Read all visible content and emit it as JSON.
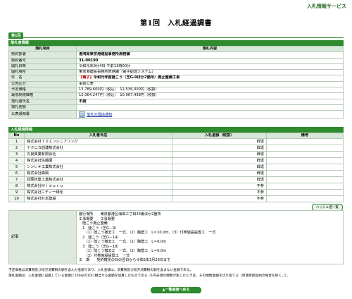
{
  "header": {
    "service": "入札情報サービス",
    "title": "第1回　入札経過調書",
    "round_badge": "第1回"
  },
  "info_section": {
    "heading": "落札者情報",
    "col_item": "落札項目",
    "col_content": "落札内容",
    "rows": [
      {
        "label": "契約部署",
        "value": "港湾局東京港建設事務所庶務課"
      },
      {
        "label": "契約番号",
        "value": "31-00190"
      },
      {
        "label": "開札日時",
        "value": "令和元年9月4日 午前11時00分"
      },
      {
        "label": "開札場所",
        "value": "東京港建設事務所庶務課（電子調達システム）"
      },
      {
        "label": "件　名",
        "tag": "【電子】",
        "value": "令和元年度陸こう（芝G-9ほか2箇所）廃止整備工事"
      },
      {
        "label": "公告区分",
        "value": "事前公表"
      },
      {
        "label": "予定価格",
        "value": "13,789,600円（税込）　12,536,000円（税抜）"
      },
      {
        "label": "最低制限価格",
        "value": "12,064,247円（税込）　10,967,498円（税抜）"
      },
      {
        "label": "落札者氏名",
        "value": "不調"
      },
      {
        "label": "落札金額",
        "value": ""
      },
      {
        "label": "公表通知書",
        "value": "落札の理由通知"
      }
    ]
  },
  "bid_section": {
    "heading": "入札経過情報",
    "col_no": "No",
    "col_name": "入札者氏名",
    "col_amount": "入札金額（税抜）",
    "col_note": "備考",
    "rows": [
      {
        "no": "1",
        "name": "株式会社ＴＤエンジニアリング",
        "amount": "辞退",
        "note": ""
      },
      {
        "no": "2",
        "name": "テクニカ創建株式会社",
        "amount": "辞退",
        "note": ""
      },
      {
        "no": "3",
        "name": "丸良興業有限会社",
        "amount": "辞退",
        "note": ""
      },
      {
        "no": "4",
        "name": "株式会社佐藤園",
        "amount": "辞退",
        "note": ""
      },
      {
        "no": "5",
        "name": "シンレキ工業株式会社",
        "amount": "辞退",
        "note": ""
      },
      {
        "no": "6",
        "name": "株式会社森岡",
        "amount": "辞退",
        "note": ""
      },
      {
        "no": "7",
        "name": "武蔵技建工業株式会社",
        "amount": "辞退",
        "note": ""
      },
      {
        "no": "8",
        "name": "株式会社Ｍｉｄｏｒｕ",
        "amount": "不参",
        "note": ""
      },
      {
        "no": "9",
        "name": "株式会社ニチノー緑化",
        "amount": "不参",
        "note": ""
      },
      {
        "no": "10",
        "name": "株式会社杉本建設",
        "amount": "不参",
        "note": ""
      }
    ],
    "hash_button": "ハッシュ値一覧"
  },
  "remarks": {
    "label": "記事",
    "text": "履行場所　　東京都港区海岸三丁目33番ほか2箇所\n工事概要　　工事概要\n　陸こう廃止整備\n　1　陸こう（芝G－9）\n　　（1）陸こう撤去工　一式、（2）胸壁工　L＝10.0m、（3）付帯施設設置工　一式\n　2　陸こう（芝G－14）\n　　（1）陸こう撤去工　一式、（2）胸壁工　L＝6.0m\n　3　陸こう（芝G－18）\n　　（1）陸こう撤去工　一式、（2）胸壁工　L＝6.0m\n　　（3）付帯施設設置工　一式\n工　期　　契約確定の日の翌日から令和2年3月26日まで"
  },
  "footnotes": [
    "予定価格は消費税及び地方消費税の額を含んだ金額であり、入札金額は、消費税及び地方消費税の額を含まない金額である。",
    "落札金額は、入札金額に記載している金額に100分の10に相当する金額を加算したものである（1円未満の端数が生じたときは、その端数金額を切り捨てる（単価参照契約の場合を除く。））。"
  ],
  "back_button": "▲一覧画面へ戻る"
}
